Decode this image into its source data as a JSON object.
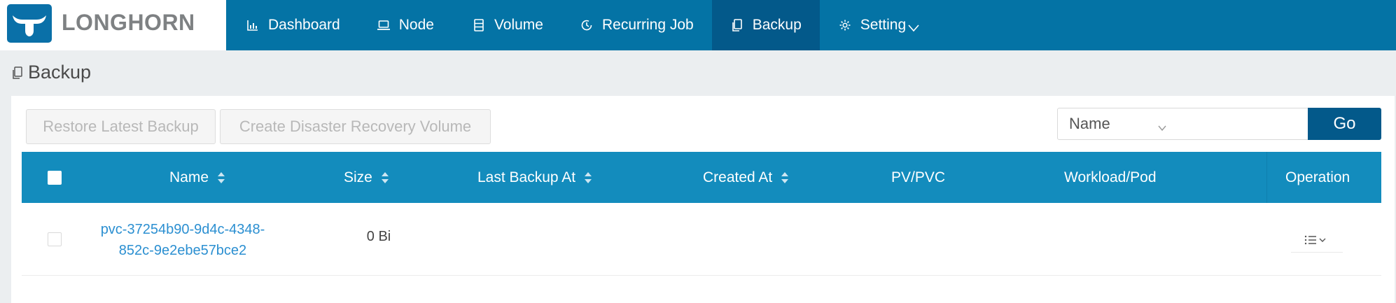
{
  "brand": {
    "name": "LONGHORN"
  },
  "nav": {
    "items": [
      {
        "label": "Dashboard",
        "icon": "bar-chart-icon"
      },
      {
        "label": "Node",
        "icon": "laptop-icon"
      },
      {
        "label": "Volume",
        "icon": "database-icon"
      },
      {
        "label": "Recurring Job",
        "icon": "clock-icon"
      },
      {
        "label": "Backup",
        "icon": "copy-icon",
        "active": true
      },
      {
        "label": "Setting",
        "icon": "gear-icon"
      }
    ]
  },
  "page": {
    "title": "Backup"
  },
  "toolbar": {
    "restore_label": "Restore Latest Backup",
    "dr_volume_label": "Create Disaster Recovery Volume",
    "search_field": "Name",
    "search_value": "",
    "go_label": "Go"
  },
  "table": {
    "columns": [
      "Name",
      "Size",
      "Last Backup At",
      "Created At",
      "PV/PVC",
      "Workload/Pod",
      "Operation"
    ],
    "rows": [
      {
        "name_line1": "pvc-37254b90-9d4c-4348-",
        "name_line2": "852c-9e2ebe57bce2",
        "size": "0 Bi",
        "last_backup_at": "",
        "created_at": "",
        "pv_pvc": "",
        "workload_pod": ""
      }
    ]
  },
  "colors": {
    "header": "#0473a5",
    "nav_active": "#03598a",
    "table_header": "#138cbd",
    "link": "#2b8fd1",
    "go_button": "#03598a"
  }
}
